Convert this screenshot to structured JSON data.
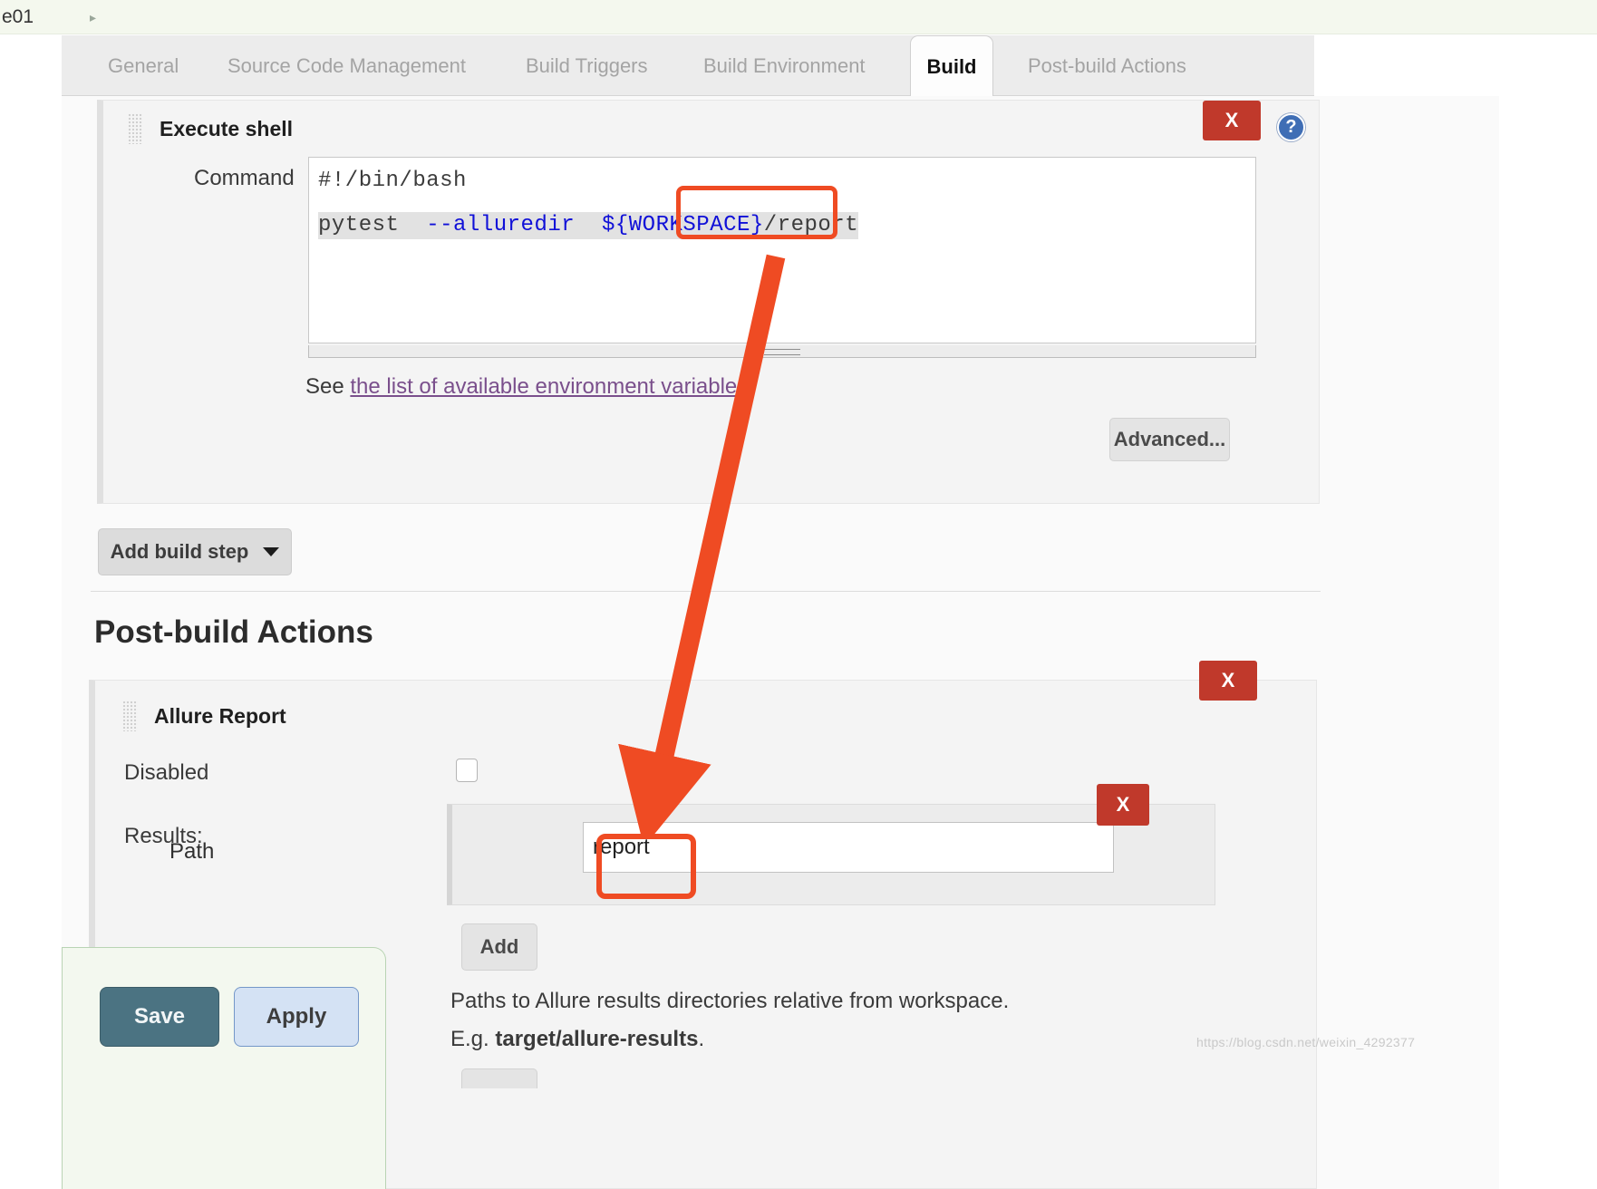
{
  "breadcrumb": {
    "label": "e01",
    "caret_icon": "chevron-right-icon"
  },
  "tabs": [
    {
      "label": "General",
      "active": false
    },
    {
      "label": "Source Code Management",
      "active": false
    },
    {
      "label": "Build Triggers",
      "active": false
    },
    {
      "label": "Build Environment",
      "active": false
    },
    {
      "label": "Build",
      "active": true
    },
    {
      "label": "Post-build Actions",
      "active": false
    }
  ],
  "build_step": {
    "title": "Execute shell",
    "delete_label": "X",
    "help_label": "?",
    "command_label": "Command",
    "command_line_1": "#!/bin/bash",
    "command_line_2_parts": {
      "a": "pytest  ",
      "b": "--alluredir",
      "c": "  ",
      "d": "${WORKSPACE}",
      "e": "/report"
    },
    "env_prefix": "See ",
    "env_link": "the list of available environment variables",
    "advanced_label": "Advanced...",
    "add_build_step_label": "Add build step"
  },
  "post_build": {
    "heading": "Post-build Actions",
    "allure": {
      "title": "Allure Report",
      "delete_label": "X",
      "disabled_label": "Disabled",
      "disabled_checked": false,
      "results_label": "Results:",
      "path_label": "Path",
      "path_value": "report",
      "path_delete_label": "X",
      "add_label": "Add",
      "helper_line_1": "Paths to Allure results directories relative from workspace.",
      "helper_line_2_prefix": "E.g. ",
      "helper_line_2_code": "target/allure-results",
      "helper_line_2_suffix": "."
    }
  },
  "footer": {
    "save_label": "Save",
    "apply_label": "Apply"
  },
  "annotations": {
    "color": "#ef4b23",
    "box_command_target": "/report",
    "box_path_target": "report",
    "arrow": "arrow-down-icon"
  },
  "watermark": {
    "text": "https://blog.csdn.net/weixin_4292377"
  }
}
